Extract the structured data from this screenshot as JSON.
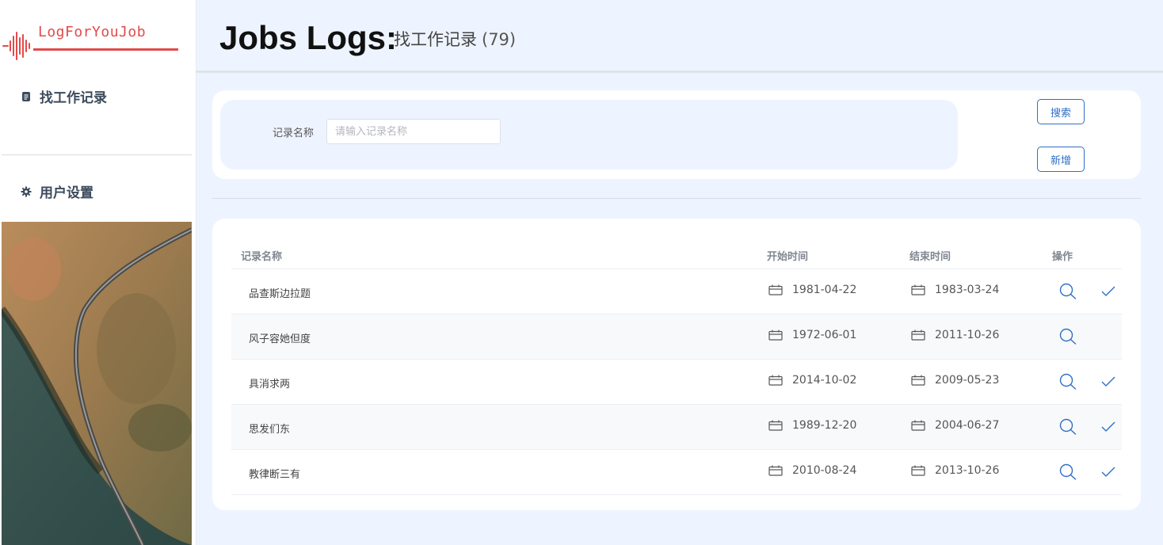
{
  "brand": {
    "name": "LogForYouJob",
    "color": "#e34a4a"
  },
  "sidebar": {
    "items": [
      {
        "label": "找工作记录",
        "icon": "document-icon"
      },
      {
        "label": "用户设置",
        "icon": "gear-icon"
      }
    ]
  },
  "header": {
    "title": "Jobs Logs:",
    "subtitle": "找工作记录",
    "count": "(79)"
  },
  "search": {
    "label": "记录名称",
    "placeholder": "请输入记录名称",
    "value": "",
    "search_button": "搜索",
    "add_button": "新增"
  },
  "table": {
    "columns": {
      "name": "记录名称",
      "start": "开始时间",
      "end": "结束时间",
      "actions": "操作"
    },
    "rows": [
      {
        "name": "品查斯边拉题",
        "start": "1981-04-22",
        "end": "1983-03-24",
        "has_check": true
      },
      {
        "name": "风子容她但度",
        "start": "1972-06-01",
        "end": "2011-10-26",
        "has_check": false
      },
      {
        "name": "具消求两",
        "start": "2014-10-02",
        "end": "2009-05-23",
        "has_check": true
      },
      {
        "name": "思发们东",
        "start": "1989-12-20",
        "end": "2004-06-27",
        "has_check": true
      },
      {
        "name": "教律断三有",
        "start": "2010-08-24",
        "end": "2013-10-26",
        "has_check": true
      }
    ]
  },
  "colors": {
    "accent": "#2f6fc6",
    "background": "#eef4ff"
  }
}
